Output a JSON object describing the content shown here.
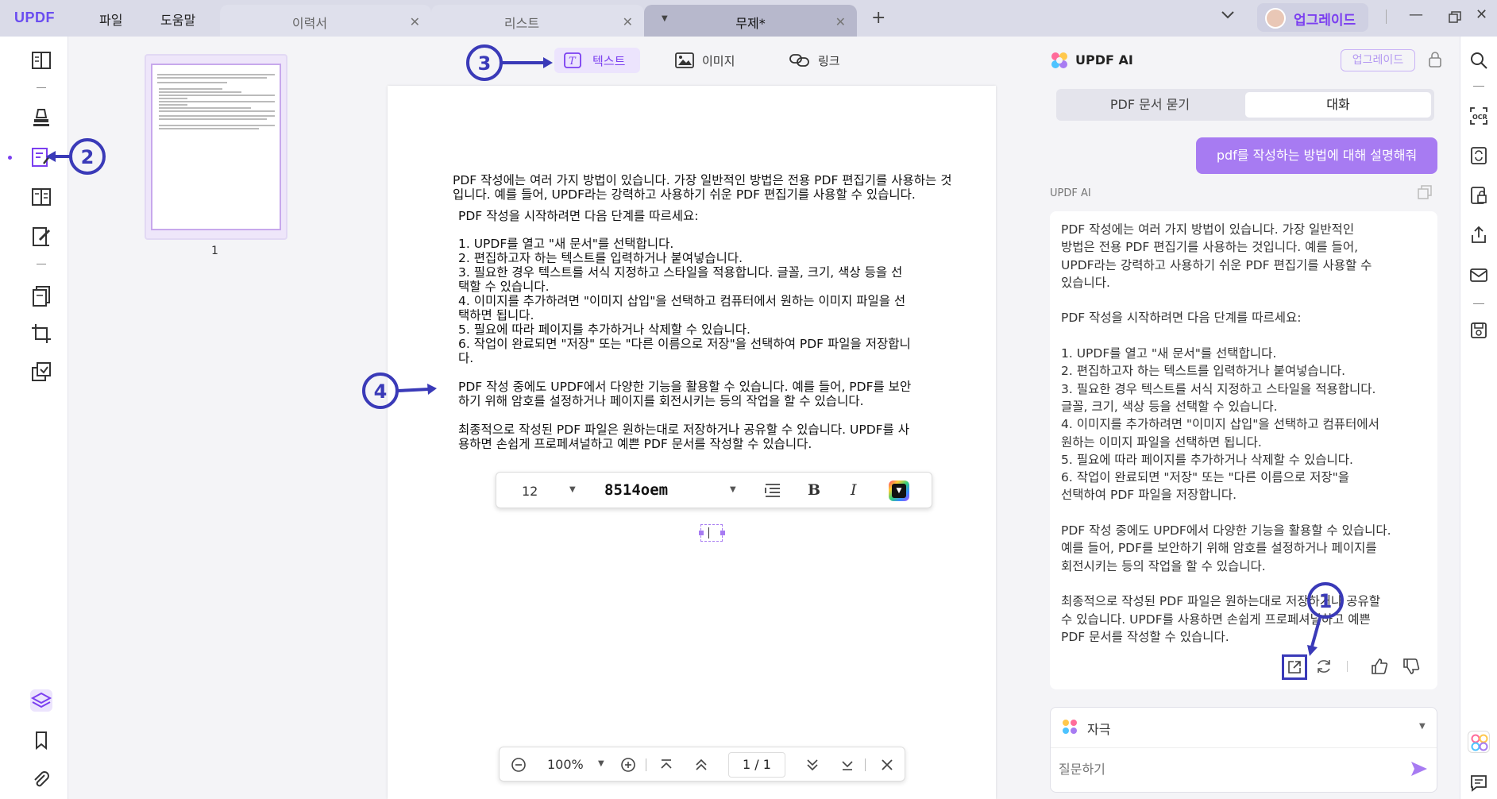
{
  "app": {
    "logo": "UPDF"
  },
  "menu": {
    "file": "파일",
    "help": "도움말"
  },
  "tabs": [
    {
      "label": "이력서"
    },
    {
      "label": "리스트"
    },
    {
      "label": "무제*"
    }
  ],
  "upgrade": {
    "label": "업그레이드"
  },
  "thumbnail": {
    "page_number": "1"
  },
  "toolbar": {
    "text": "텍스트",
    "image": "이미지",
    "link": "링크"
  },
  "document": {
    "lines": [
      "PDF 작성에는 여러 가지 방법이 있습니다. 가장 일반적인 방법은 전용 PDF 편집기를 사용하는 것",
      "입니다. 예를 들어, UPDF라는 강력하고 사용하기 쉬운 PDF 편집기를 사용할 수 있습니다.",
      "PDF 작성을 시작하려면 다음 단계를 따르세요:",
      "1. UPDF를 열고 \"새 문서\"를 선택합니다.",
      "2. 편집하고자 하는 텍스트를 입력하거나 붙여넣습니다.",
      "3. 필요한 경우 텍스트를 서식 지정하고 스타일을 적용합니다. 글꼴, 크기, 색상 등을 선",
      "택할 수 있습니다.",
      "4. 이미지를 추가하려면 \"이미지 삽입\"을 선택하고 컴퓨터에서 원하는 이미지 파일을 선",
      "택하면 됩니다.",
      "5. 필요에 따라 페이지를 추가하거나 삭제할 수 있습니다.",
      "6. 작업이 완료되면 \"저장\" 또는 \"다른 이름으로 저장\"을 선택하여 PDF 파일을 저장합니",
      "다.",
      "PDF 작성 중에도 UPDF에서 다양한 기능을 활용할 수 있습니다. 예를 들어, PDF를 보안",
      "하기 위해 암호를 설정하거나 페이지를 회전시키는 등의 작업을 할 수 있습니다.",
      "최종적으로 작성된 PDF 파일은 원하는대로 저장하거나 공유할 수 있습니다. UPDF를 사",
      "용하면 손쉽게 프로페셔널하고 예쁜 PDF 문서를 작성할 수 있습니다."
    ]
  },
  "text_toolbar": {
    "font_size": "12",
    "font_name": "8514oem",
    "bold": "B",
    "italic": "I",
    "color": "#111111"
  },
  "page_nav": {
    "zoom": "100%",
    "page": "1 / 1"
  },
  "ai": {
    "title": "UPDF AI",
    "upgrade": "업그레이드",
    "mode_tabs": [
      "PDF 문서 묻기",
      "대화"
    ],
    "user_message": "pdf를 작성하는 방법에 대해 설명해줘",
    "sender": "UPDF AI",
    "response": "PDF 작성에는 여러 가지 방법이 있습니다. 가장 일반적인\n방법은 전용 PDF 편집기를 사용하는 것입니다. 예를 들어,\nUPDF라는 강력하고 사용하기 쉬운 PDF 편집기를 사용할 수\n있습니다.\n\nPDF 작성을 시작하려면 다음 단계를 따르세요:\n\n1. UPDF를 열고 \"새 문서\"를 선택합니다.\n2. 편집하고자 하는 텍스트를 입력하거나 붙여넣습니다.\n3. 필요한 경우 텍스트를 서식 지정하고 스타일을 적용합니다.\n글꼴, 크기, 색상 등을 선택할 수 있습니다.\n4. 이미지를 추가하려면 \"이미지 삽입\"을 선택하고 컴퓨터에서\n원하는 이미지 파일을 선택하면 됩니다.\n5. 필요에 따라 페이지를 추가하거나 삭제할 수 있습니다.\n6. 작업이 완료되면 \"저장\" 또는 \"다른 이름으로 저장\"을\n선택하여 PDF 파일을 저장합니다.\n\nPDF 작성 중에도 UPDF에서 다양한 기능을 활용할 수 있습니다.\n예를 들어, PDF를 보안하기 위해 암호를 설정하거나 페이지를\n회전시키는 등의 작업을 할 수 있습니다.\n\n최종적으로 작성된 PDF 파일은 원하는대로 저장하거나 공유할\n수 있습니다. UPDF를 사용하면 손쉽게 프로페셔널하고 예쁜\nPDF 문서를 작성할 수 있습니다.",
    "prompt_chip": "자극",
    "input_placeholder": "질문하기"
  },
  "annotations": [
    "1",
    "2",
    "3",
    "4"
  ],
  "colors": {
    "accent": "#7b3ff0",
    "bubble": "#a77bf2",
    "annotation": "#3a3ab8"
  }
}
